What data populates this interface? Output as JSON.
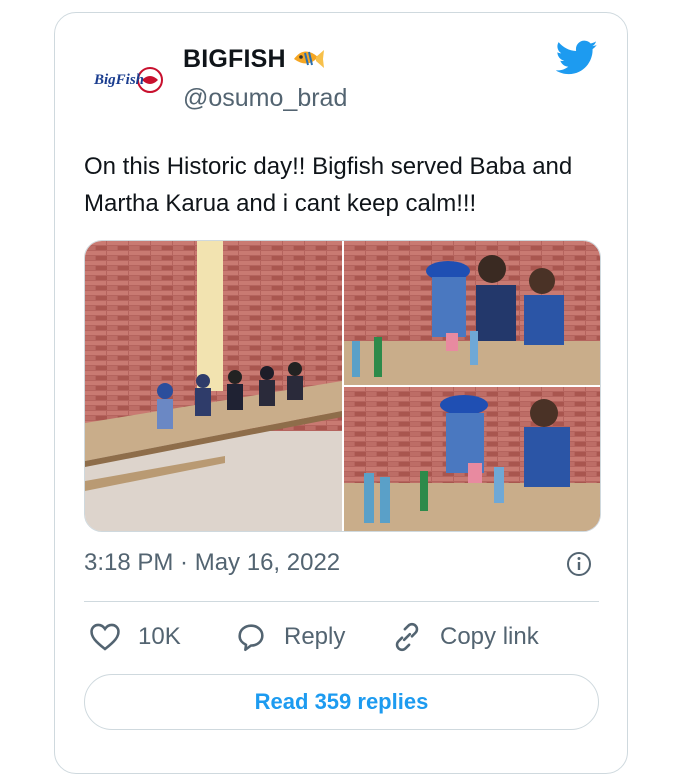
{
  "tweet": {
    "display_name": "BIGFISH",
    "name_emoji": "fish-emoji-icon",
    "handle": "@osumo_brad",
    "avatar_text": "BigFish",
    "text": "On this Historic day!! Bigfish served Baba and Martha Karua and i cant keep calm!!!",
    "timestamp": "3:18 PM · May 16, 2022"
  },
  "actions": {
    "like_count": "10K",
    "reply_label": "Reply",
    "copy_label": "Copy link",
    "read_replies_label": "Read 359 replies"
  },
  "media": {
    "photos": [
      "restaurant-dining-room-photo",
      "guests-at-table-photo-1",
      "guests-at-table-photo-2"
    ]
  },
  "colors": {
    "brand_blue": "#1d9bf0",
    "muted_text": "#536471",
    "border": "#cfd9de"
  }
}
